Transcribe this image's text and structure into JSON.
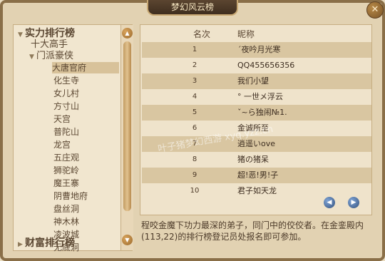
{
  "window": {
    "title": "梦幻风云榜",
    "close_label": "✕"
  },
  "left_tree": {
    "top_items": [
      "实力排行榜",
      "财富排行榜"
    ],
    "mid_items": [
      "十大高手",
      "门派豪侠"
    ],
    "sub_items": [
      "大唐官府",
      "化生寺",
      "女儿村",
      "方寸山",
      "天宫",
      "普陀山",
      "龙宫",
      "五庄观",
      "狮驼岭",
      "魔王寨",
      "阴曹地府",
      "盘丝洞",
      "神木林",
      "凌波城",
      "无底洞"
    ],
    "selected": "大唐官府"
  },
  "right_table": {
    "headers": {
      "rank": "名次",
      "name": "昵称"
    },
    "rows": [
      {
        "rank": "1",
        "name": "ˊ夜吟月光寒"
      },
      {
        "rank": "2",
        "name": "QQ455656356"
      },
      {
        "rank": "3",
        "name": "我们小望"
      },
      {
        "rank": "4",
        "name": "° 一世メ浮云"
      },
      {
        "rank": "5",
        "name": "ˇ~ら独闹№1."
      },
      {
        "rank": "6",
        "name": "金诚所至"
      },
      {
        "rank": "7",
        "name": "逍遥いove"
      },
      {
        "rank": "8",
        "name": "猪の猪呆"
      },
      {
        "rank": "9",
        "name": "超!恶!男!子"
      },
      {
        "rank": "10",
        "name": "君子如天龙"
      }
    ],
    "nav": {
      "prev": "◀",
      "next": "▶"
    }
  },
  "description": "程咬金魔下功力最深的弟子，同门中的佼佼者。在金銮殿内(113,22)的排行榜登记员处报名即可参加。",
  "watermark": "叶子猪梦幻西游 xyq.yzz.cn"
}
